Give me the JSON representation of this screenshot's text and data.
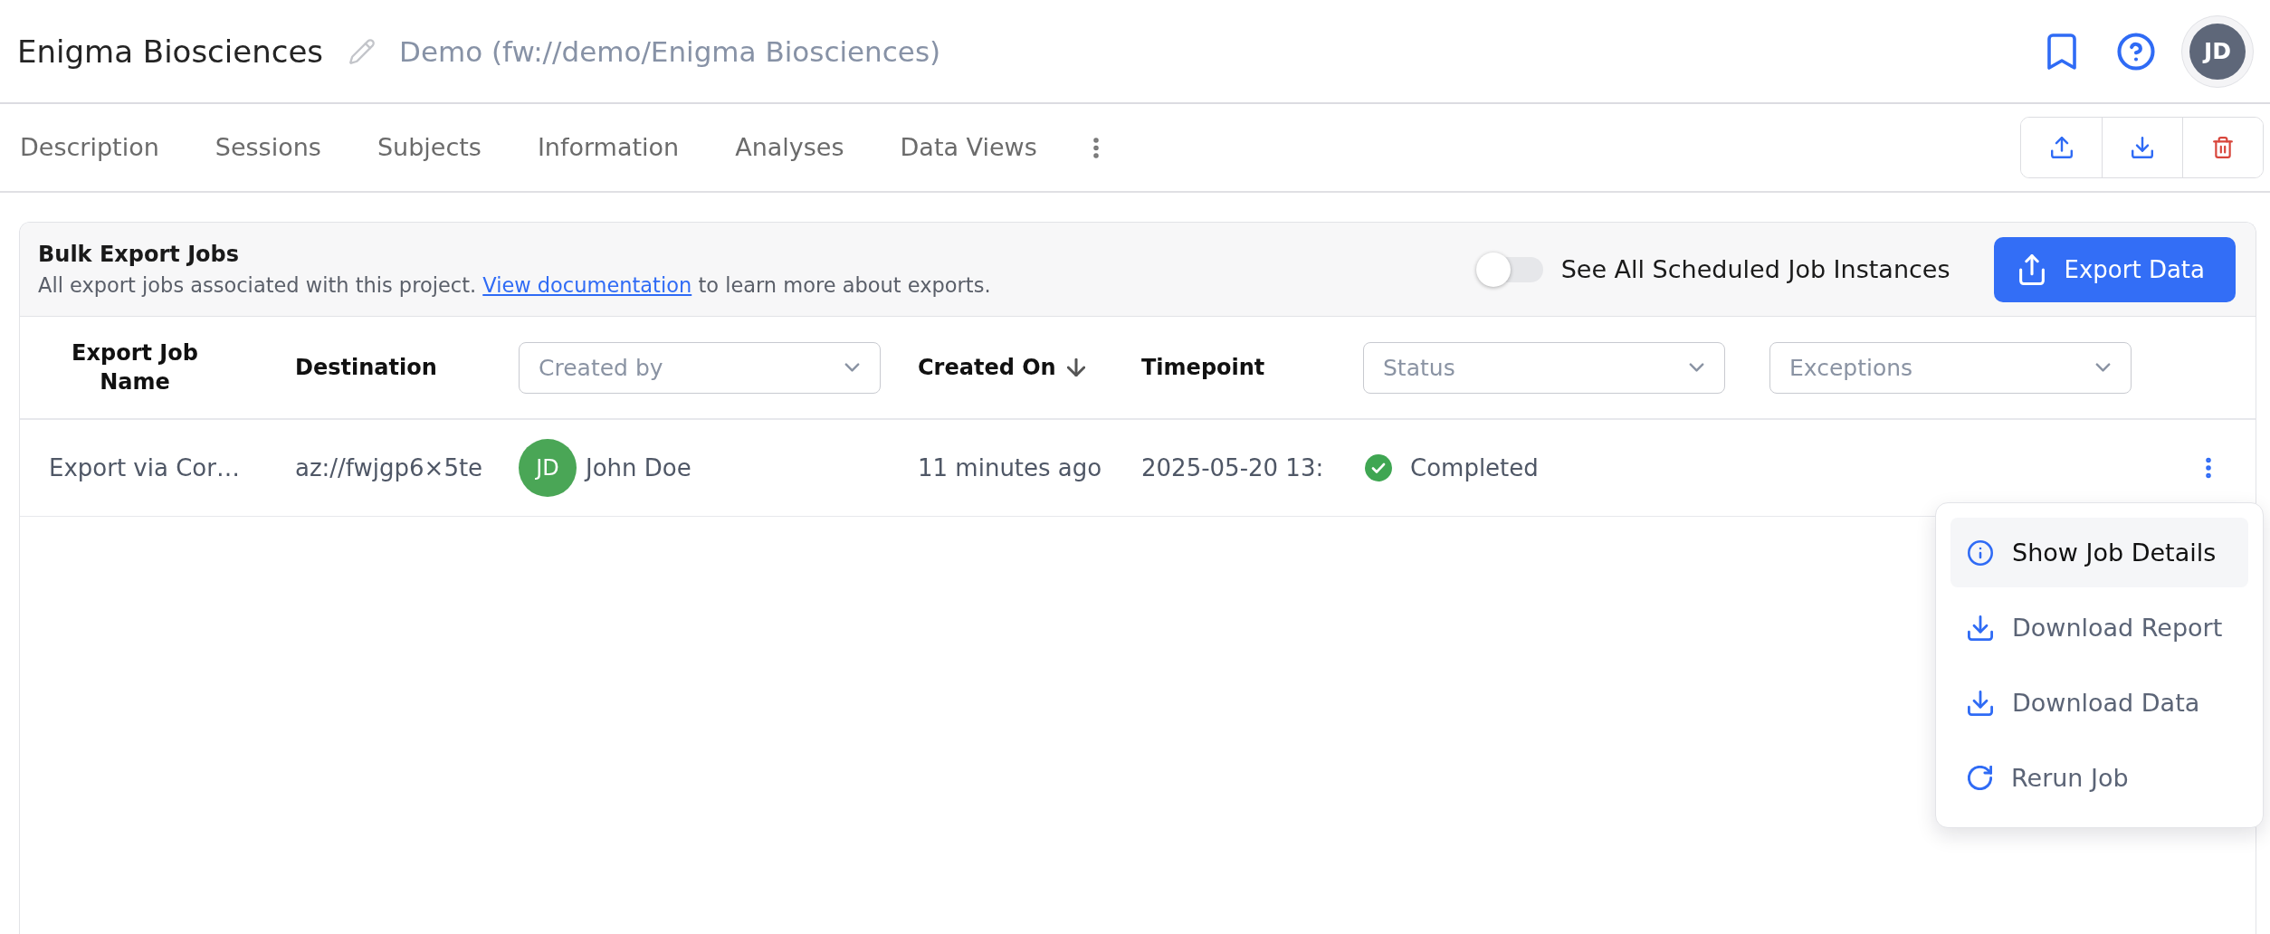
{
  "header": {
    "title": "Enigma Biosciences",
    "path": "Demo (fw://demo/Enigma Biosciences)",
    "user_initials": "JD"
  },
  "tabs": [
    {
      "label": "Description",
      "selected": false
    },
    {
      "label": "Sessions",
      "selected": false
    },
    {
      "label": "Subjects",
      "selected": false
    },
    {
      "label": "Information",
      "selected": false
    },
    {
      "label": "Analyses",
      "selected": false
    },
    {
      "label": "Data Views",
      "selected": false
    }
  ],
  "panel": {
    "title": "Bulk Export Jobs",
    "description_before": "All export jobs associated with this project.",
    "link": "View documentation",
    "description_after": "to learn more about exports.",
    "toggle": {
      "label": "See All Scheduled Job Instances",
      "on": false
    },
    "primary_button": "Export Data"
  },
  "table": {
    "columns": [
      {
        "kind": "text",
        "label": "Export Job Name"
      },
      {
        "kind": "text",
        "label": "Destination"
      },
      {
        "kind": "filter",
        "placeholder": "Created by"
      },
      {
        "kind": "sort",
        "label": "Created On",
        "descending": true
      },
      {
        "kind": "text",
        "label": "Timepoint"
      },
      {
        "kind": "filter",
        "placeholder": "Status"
      },
      {
        "kind": "filter",
        "placeholder": "Exceptions"
      }
    ],
    "rows": [
      {
        "name": "Export via Cor…",
        "destination": "az://fwjgp6×5te",
        "creator_initials": "JD",
        "creator": "John Doe",
        "created_on": "11 minutes ago",
        "timepoint": "2025-05-20 13:",
        "status": {
          "kind": "completed",
          "label": "Completed"
        }
      }
    ]
  },
  "menu": [
    {
      "kind": "details",
      "label": "Show Job Details",
      "highlighted": true
    },
    {
      "kind": "download",
      "label": "Download Report",
      "highlighted": false
    },
    {
      "kind": "download",
      "label": "Download Data",
      "highlighted": false
    },
    {
      "kind": "rerun",
      "label": "Rerun Job",
      "highlighted": false
    }
  ]
}
